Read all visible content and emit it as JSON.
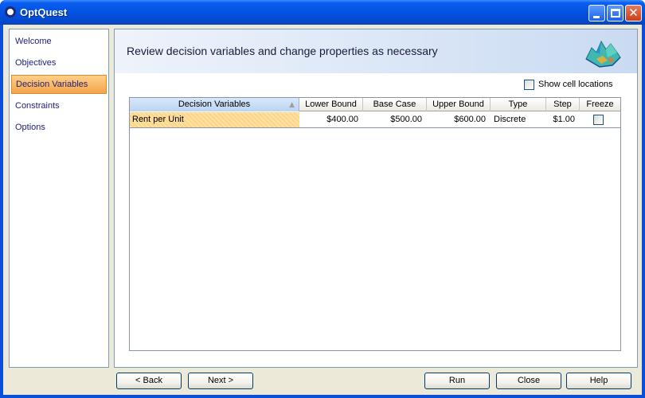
{
  "window": {
    "title": "OptQuest"
  },
  "sidebar": {
    "items": [
      {
        "label": "Welcome"
      },
      {
        "label": "Objectives"
      },
      {
        "label": "Decision Variables",
        "selected": true
      },
      {
        "label": "Constraints"
      },
      {
        "label": "Options"
      }
    ]
  },
  "main": {
    "heading": "Review decision variables and change properties as necessary",
    "show_cell_locations": {
      "label": "Show cell locations",
      "checked": false
    },
    "grid": {
      "columns": [
        "Decision Variables",
        "Lower Bound",
        "Base Case",
        "Upper Bound",
        "Type",
        "Step",
        "Freeze"
      ],
      "rows": [
        {
          "name": "Rent per Unit",
          "lower": "$400.00",
          "base": "$500.00",
          "upper": "$600.00",
          "type": "Discrete",
          "step": "$1.00",
          "freeze": false
        }
      ]
    }
  },
  "footer": {
    "back": "< Back",
    "next": "Next >",
    "run": "Run",
    "close": "Close",
    "help": "Help"
  },
  "colors": {
    "title_bar": "#0554e3",
    "selected_nav": "#f3a44a",
    "row_highlight": "#fde2a6"
  }
}
